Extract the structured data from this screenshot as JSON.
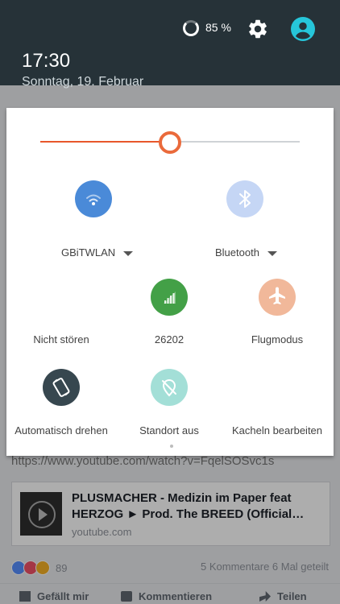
{
  "status": {
    "battery": "85 %",
    "time": "17:30",
    "date": "Sonntag, 19. Februar"
  },
  "colors": {
    "shade_bg": "#263238",
    "accent": "#e8572b",
    "wifi_active": "#4a8ad8",
    "bluetooth_inactive": "#c5d6f5",
    "mobile_active": "#43a047",
    "flight_inactive": "#f1b89a",
    "rotate_active": "#37474f",
    "location_inactive": "#a3dfd7"
  },
  "brightness": {
    "level": 0.5
  },
  "tiles": {
    "wifi": {
      "label": "GBiTWLAN",
      "icon": "wifi-icon"
    },
    "bluetooth": {
      "label": "Bluetooth",
      "icon": "bluetooth-icon"
    },
    "dnd": {
      "label": "Nicht stören",
      "icon": "do-not-disturb-icon"
    },
    "mobile": {
      "label": "26202",
      "icon": "signal-icon"
    },
    "flight": {
      "label": "Flugmodus",
      "icon": "airplane-icon"
    },
    "rotate": {
      "label": "Automatisch drehen",
      "icon": "rotate-icon"
    },
    "location": {
      "label": "Standort aus",
      "icon": "location-off-icon"
    },
    "edit": {
      "label": "Kacheln bearbeiten",
      "icon": "edit-icon"
    }
  },
  "background": {
    "url": "https://www.youtube.com/watch?v=FqelSOSvc1s",
    "card_title": "PLUSMACHER - Medizin im Paper feat HERZOG ► Prod. The BREED (Official…",
    "card_domain": "youtube.com",
    "reaction_count": "89",
    "comments_shares": "5 Kommentare 6 Mal geteilt",
    "actions": [
      "Gefällt mir",
      "Kommentieren",
      "Teilen"
    ]
  }
}
